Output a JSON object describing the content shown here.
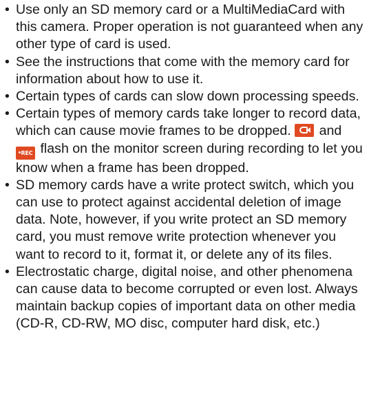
{
  "bullet_symbol": "•",
  "items": [
    {
      "text": "Use only an SD memory card or a MultiMediaCard with this camera. Proper operation is not guaranteed when any other type of card is used."
    },
    {
      "text": "See the instructions that come with the memory card for information about how to use it."
    },
    {
      "text": "Certain types of cards can slow down processing speeds."
    },
    {
      "text_before": "Certain types of memory cards take longer to record data, which can cause movie frames to be dropped.",
      "icon_1": "movie-camera-icon",
      "joiner": "and",
      "icon_2_label": "REC",
      "text_after": "flash on the monitor screen during recording to let you know when a frame has been dropped."
    },
    {
      "text": "SD memory cards have a write protect switch, which you can use to protect against accidental deletion of image data. Note, however, if you write protect an SD memory card, you must remove write protection whenever you want to record to it, format it, or delete any of its files."
    },
    {
      "text": "Electrostatic charge, digital noise, and other phenomena can cause data to become corrupted or even lost. Always maintain backup copies of important data on other media (CD-R, CD-RW, MO disc, computer hard disk, etc.)"
    }
  ],
  "colors": {
    "icon_background": "#e04a22",
    "text": "#1a1a1a"
  }
}
